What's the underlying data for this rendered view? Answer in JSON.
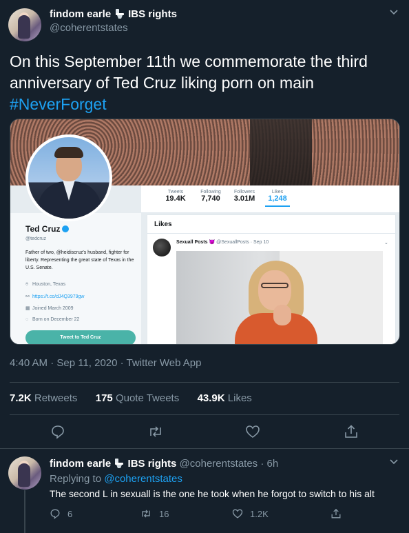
{
  "tweet": {
    "author_name": "findom earle",
    "author_name_suffix": "IBS rights",
    "author_handle": "@coherentstates",
    "text": "On this September 11th we commemorate the third anniversary of Ted Cruz liking porn on main",
    "hashtag": "#NeverForget",
    "timestamp": "4:40 AM · Sep 11, 2020 · Twitter Web App",
    "stats": {
      "retweets_count": "7.2K",
      "retweets_label": "Retweets",
      "quotes_count": "175",
      "quotes_label": "Quote Tweets",
      "likes_count": "43.9K",
      "likes_label": "Likes"
    }
  },
  "embedded_profile": {
    "name": "Ted Cruz",
    "handle": "@tedcruz",
    "bio": "Father of two, @heidiscruz's husband, fighter for liberty. Representing the great state of Texas in the U.S. Senate.",
    "location": "Houston, Texas",
    "url": "https://t.co/dJ4Q3979gw",
    "joined": "Joined March 2009",
    "born": "Born on December 22",
    "tweet_button": "Tweet to Ted Cruz",
    "stats": [
      {
        "label": "Tweets",
        "value": "19.4K"
      },
      {
        "label": "Following",
        "value": "7,740"
      },
      {
        "label": "Followers",
        "value": "3.01M"
      },
      {
        "label": "Likes",
        "value": "1,248"
      }
    ],
    "likes_heading": "Likes",
    "liked_tweet": {
      "name": "Sexuall Posts",
      "handle": "@SexuallPosts",
      "date": "· Sep 10"
    }
  },
  "reply": {
    "author_name": "findom earle",
    "author_name_suffix": "IBS rights",
    "author_handle": "@coherentstates",
    "time": "· 6h",
    "replying_prefix": "Replying to",
    "replying_handle": "@coherentstates",
    "text": "The second L in sexuall is the one he took when he forgot to switch to his alt",
    "reply_count": "6",
    "retweet_count": "16",
    "like_count": "1.2K"
  },
  "colors": {
    "background": "#15202b",
    "accent": "#1da1f2",
    "muted": "#8899a6",
    "divider": "#38444d"
  }
}
